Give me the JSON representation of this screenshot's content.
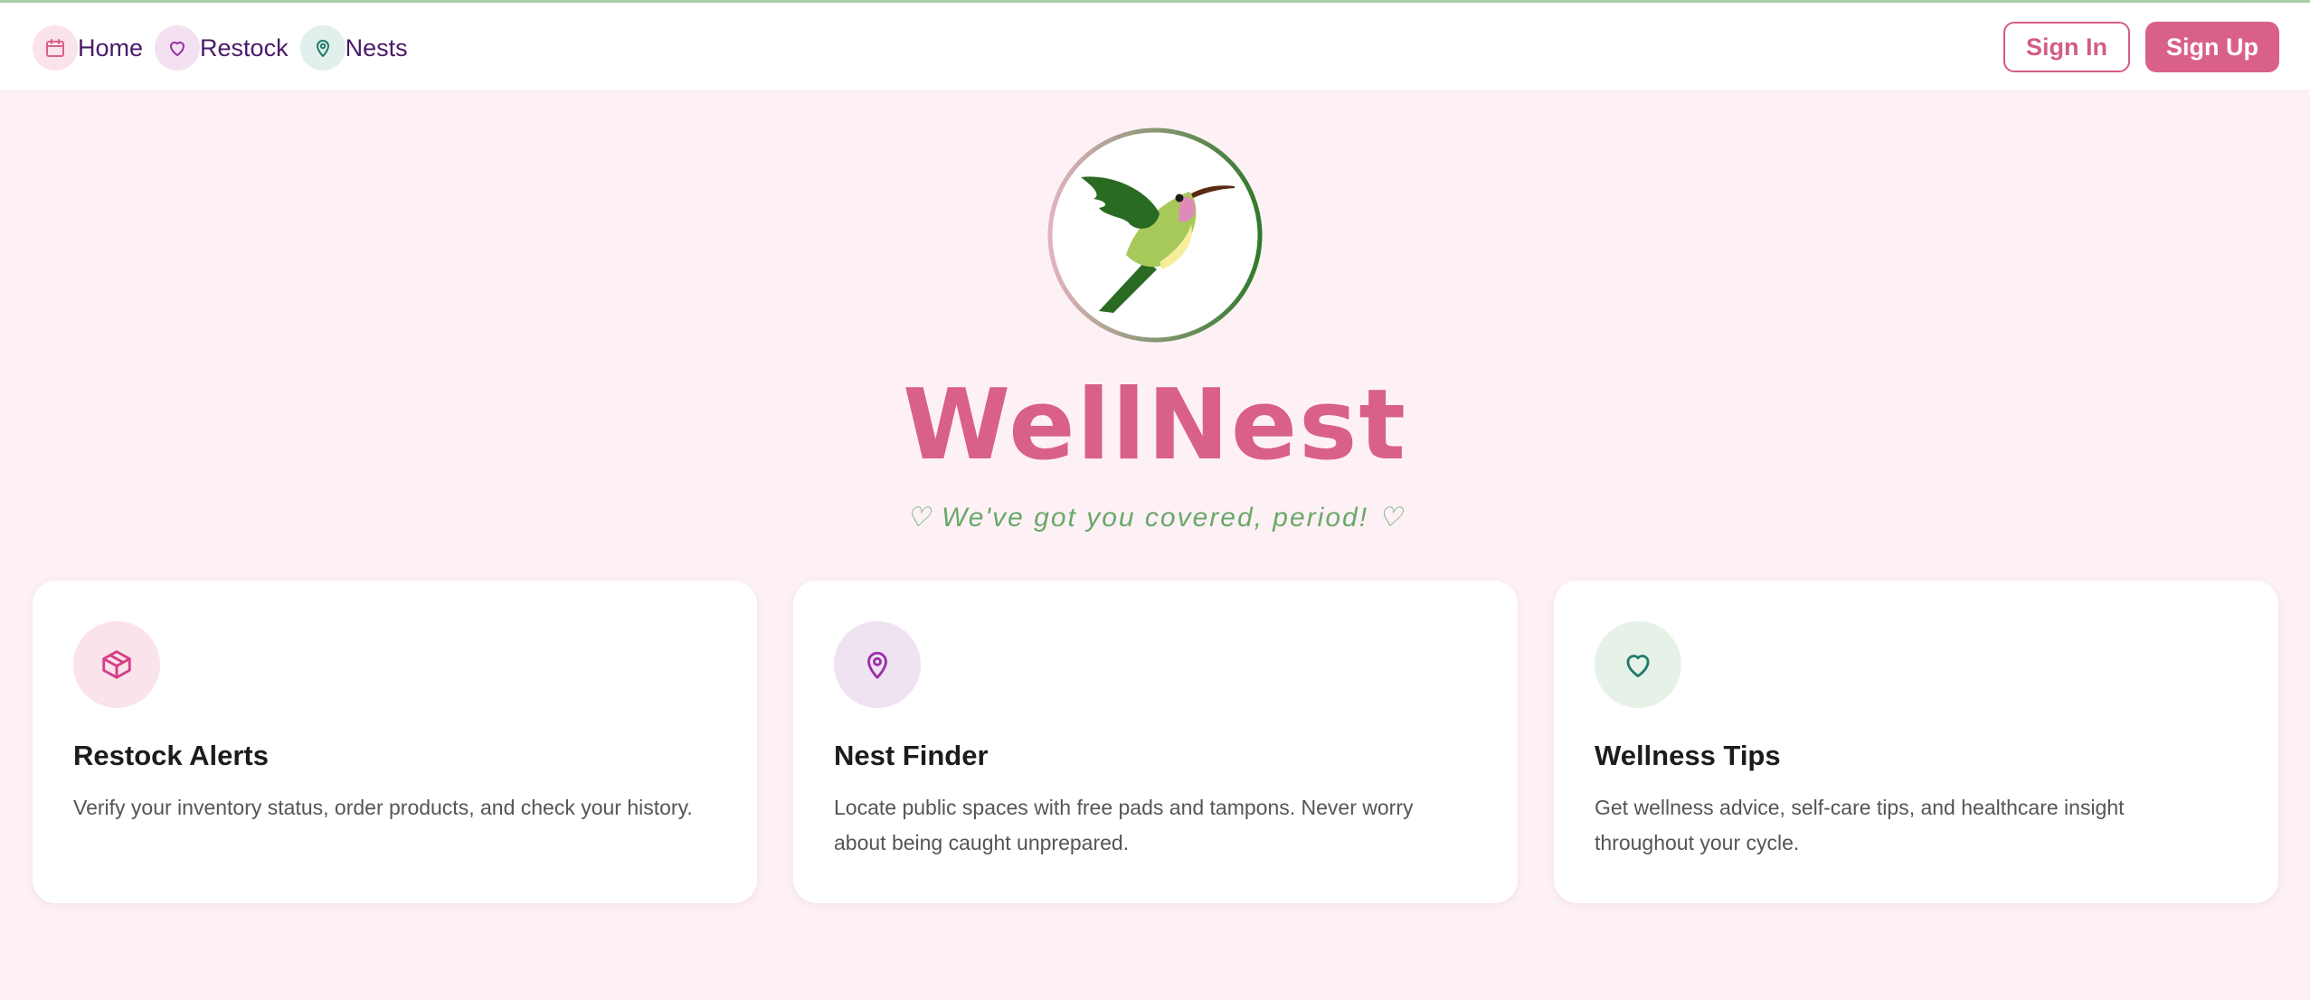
{
  "nav": {
    "items": [
      {
        "label": "Home",
        "icon": "calendar-icon"
      },
      {
        "label": "Restock",
        "icon": "heart-icon"
      },
      {
        "label": "Nests",
        "icon": "map-pin-icon"
      }
    ]
  },
  "auth": {
    "sign_in": "Sign In",
    "sign_up": "Sign Up"
  },
  "hero": {
    "logo_icon": "hummingbird-logo",
    "title": "WellNest",
    "tagline": "♡ We've got you covered, period! ♡"
  },
  "cards": [
    {
      "icon": "package-icon",
      "title": "Restock Alerts",
      "desc": "Verify your inventory status, order products, and check your history."
    },
    {
      "icon": "map-pin-icon",
      "title": "Nest Finder",
      "desc": "Locate public spaces with free pads and tampons. Never worry about being caught unprepared."
    },
    {
      "icon": "heart-icon",
      "title": "Wellness Tips",
      "desc": "Get wellness advice, self-care tips, and healthcare insight throughout your cycle."
    }
  ],
  "colors": {
    "brand": "#d9608a",
    "accent_green": "#6aa86a",
    "nav_text": "#4a1a6b",
    "background": "#fdf1f5"
  }
}
